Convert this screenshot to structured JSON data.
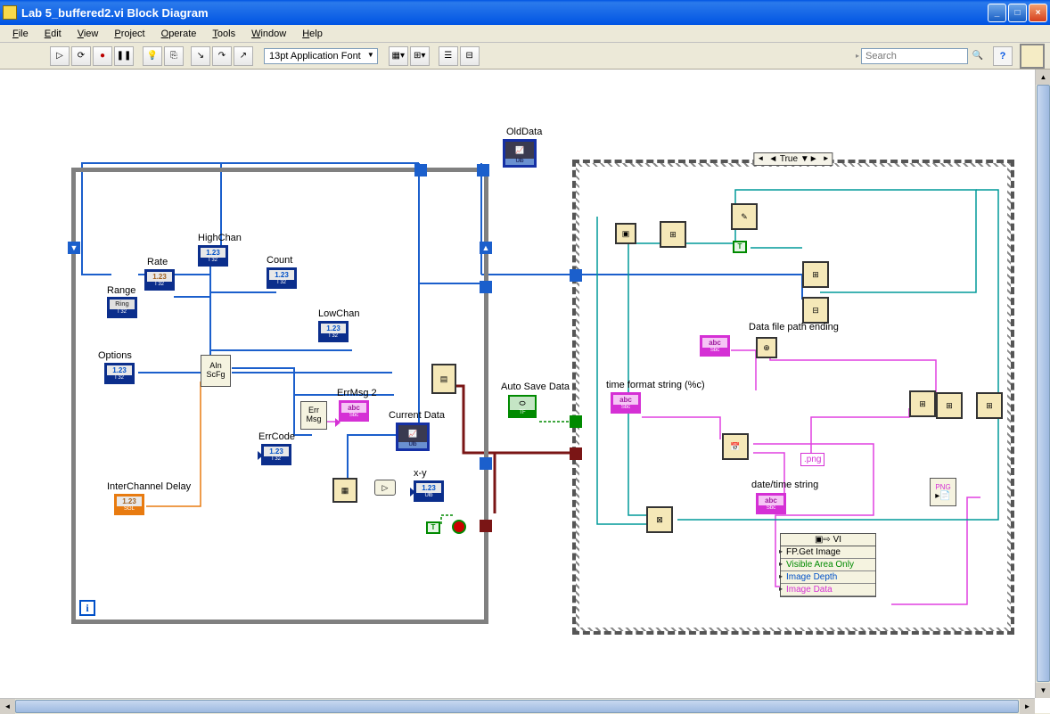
{
  "window": {
    "title": "Lab 5_buffered2.vi Block Diagram",
    "min": "_",
    "max": "□",
    "close": "×"
  },
  "menu": {
    "file": "File",
    "edit": "Edit",
    "view": "View",
    "project": "Project",
    "operate": "Operate",
    "tools": "Tools",
    "window": "Window",
    "help": "Help"
  },
  "toolbar": {
    "font": "13pt Application Font",
    "search_placeholder": "Search"
  },
  "terminals": {
    "old_data": "OldData",
    "high_chan": "HighChan",
    "rate": "Rate",
    "count": "Count",
    "range": "Range",
    "low_chan": "LowChan",
    "options": "Options",
    "err_msg2": "ErrMsg 2",
    "current_data": "Current Data",
    "err_code": "ErrCode",
    "inter_channel_delay": "InterChannel Delay",
    "xy": "x-y",
    "auto_save": "Auto Save Data",
    "time_format": "time format string (%c)",
    "data_file_path": "Data file path ending",
    "date_time": "date/time string",
    "png_ext": ".png",
    "t123": "1.23",
    "ring": "Ring",
    "abc": "abc",
    "sbc": "Sbc",
    "tf": "TF",
    "ulb": "Ulb",
    "i32": "I 32",
    "sgl": "SGL",
    "true": "T",
    "i": "i",
    "png": "PNG"
  },
  "nodes": {
    "aln_scfg": "AIn\nScFg",
    "err_msg": "Err\nMsg"
  },
  "case": {
    "selector": "True"
  },
  "prop_node": {
    "header": "VI",
    "r1": "FP.Get Image",
    "r2": "Visible Area Only",
    "r3": "Image Depth",
    "r4": "Image Data"
  }
}
